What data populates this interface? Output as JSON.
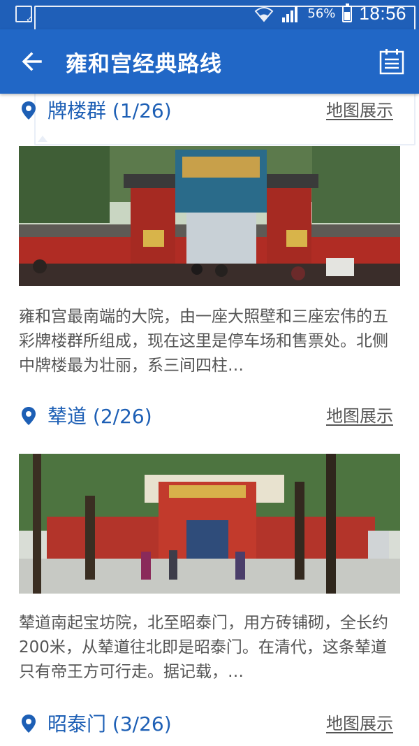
{
  "status_bar": {
    "battery_pct": "56%",
    "clock": "18:56",
    "icons": [
      "download-done-icon",
      "photo-icon",
      "wifi-icon",
      "signal-icon",
      "battery-icon"
    ]
  },
  "app_bar": {
    "title": "雍和宫经典路线",
    "back_icon": "arrow-left-icon",
    "menu_icon": "list-icon"
  },
  "spots": [
    {
      "title": "牌楼群 (1/26)",
      "map_label": "地图展示",
      "description": "雍和宫最南端的大院，由一座大照壁和三座宏伟的五彩牌楼群所组成，现在这里是停车场和售票处。北侧中牌楼最为壮丽，系三间四柱…"
    },
    {
      "title": "辇道 (2/26)",
      "map_label": "地图展示",
      "description": "辇道南起宝坊院，北至昭泰门，用方砖铺砌，全长约200米，从辇道往北即是昭泰门。在清代，这条辇道只有帝王方可行走。据记载，…"
    },
    {
      "title": "昭泰门 (3/26)",
      "map_label": "地图展示",
      "description": ""
    }
  ],
  "colors": {
    "status_bar": "#1f5fb8",
    "app_bar": "#2167c6",
    "accent_text": "#1d5fb5",
    "body_text": "#555555"
  }
}
